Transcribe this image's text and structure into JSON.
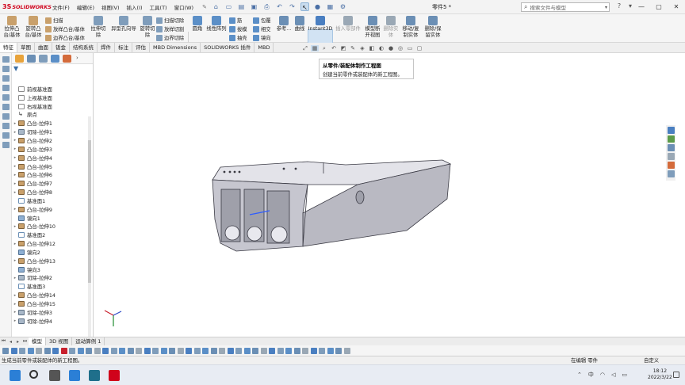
{
  "app": {
    "logo_ds": "3S",
    "logo_text": "SOLIDWORKS",
    "menus": [
      "文件(F)",
      "编辑(E)",
      "视图(V)",
      "插入(I)",
      "工具(T)",
      "窗口(W)"
    ],
    "document_title": "零件5 *",
    "search_placeholder": "搜索文件与模型"
  },
  "ribbon": {
    "buttons": [
      {
        "label": "拉伸凸\n台/基体",
        "color": "#c9a06b"
      },
      {
        "label": "旋转凸\n台/基体",
        "color": "#c9a06b"
      },
      {
        "label": "拉伸切\n除",
        "color": "#7f9dbb"
      },
      {
        "label": "异型孔向导",
        "color": "#7f9dbb"
      },
      {
        "label": "旋转切\n除",
        "color": "#7f9dbb"
      },
      {
        "label": "圆角",
        "color": "#5b8fc7"
      },
      {
        "label": "线性阵列",
        "color": "#5b8fc7"
      },
      {
        "label": "参考...",
        "color": "#6b8fb5"
      },
      {
        "label": "曲线",
        "color": "#6b8fb5"
      },
      {
        "label": "Instant3D",
        "color": "#4a7fc1"
      },
      {
        "label": "插入零部件",
        "color": "#9aa8b5"
      },
      {
        "label": "模型断\n开视图",
        "color": "#6b8fb5"
      },
      {
        "label": "删除实\n体",
        "color": "#9aa8b5"
      },
      {
        "label": "移动/复\n制实体",
        "color": "#6b8fb5"
      },
      {
        "label": "删除/保\n留实体",
        "color": "#6b8fb5"
      }
    ],
    "small": [
      "扫描",
      "放样凸台/基体",
      "边界凸台/基体",
      "扫描切除",
      "放样切割",
      "边界切除",
      "筋",
      "拔模",
      "抽壳",
      "包覆",
      "相交",
      "镜向"
    ]
  },
  "tabs": [
    "特征",
    "草图",
    "曲面",
    "钣金",
    "结构系统",
    "焊件",
    "标注",
    "评估",
    "MBD Dimensions",
    "SOLIDWORKS 插件",
    "MBD"
  ],
  "active_tab": 0,
  "tooltip": {
    "title": "从零件/装配体制作工程图",
    "desc": "创建当前零件或装配体的新工程图。"
  },
  "tree": [
    {
      "label": "前视基准面",
      "icon": "plane",
      "exp": false
    },
    {
      "label": "上视基准面",
      "icon": "plane",
      "exp": false
    },
    {
      "label": "右视基准面",
      "icon": "plane",
      "exp": false
    },
    {
      "label": "原点",
      "icon": "origin",
      "exp": false
    },
    {
      "label": "凸台-拉伸1",
      "icon": "boss",
      "exp": true
    },
    {
      "label": "切除-拉伸1",
      "icon": "cut",
      "exp": true
    },
    {
      "label": "凸台-拉伸2",
      "icon": "boss",
      "exp": true
    },
    {
      "label": "凸台-拉伸3",
      "icon": "boss",
      "exp": true
    },
    {
      "label": "凸台-拉伸4",
      "icon": "boss",
      "exp": true
    },
    {
      "label": "凸台-拉伸5",
      "icon": "boss",
      "exp": true
    },
    {
      "label": "凸台-拉伸6",
      "icon": "boss",
      "exp": true
    },
    {
      "label": "凸台-拉伸7",
      "icon": "boss",
      "exp": true
    },
    {
      "label": "凸台-拉伸8",
      "icon": "boss",
      "exp": true
    },
    {
      "label": "基准面1",
      "icon": "refplane",
      "exp": false
    },
    {
      "label": "凸台-拉伸9",
      "icon": "boss",
      "exp": true
    },
    {
      "label": "镜向1",
      "icon": "mirror",
      "exp": false
    },
    {
      "label": "凸台-拉伸10",
      "icon": "boss",
      "exp": true
    },
    {
      "label": "基准面2",
      "icon": "refplane",
      "exp": false
    },
    {
      "label": "凸台-拉伸12",
      "icon": "boss",
      "exp": true
    },
    {
      "label": "镜向2",
      "icon": "mirror",
      "exp": false
    },
    {
      "label": "凸台-拉伸13",
      "icon": "boss",
      "exp": true
    },
    {
      "label": "镜向3",
      "icon": "mirror",
      "exp": false
    },
    {
      "label": "切除-拉伸2",
      "icon": "cut",
      "exp": true
    },
    {
      "label": "基准面3",
      "icon": "refplane",
      "exp": false
    },
    {
      "label": "凸台-拉伸14",
      "icon": "boss",
      "exp": true
    },
    {
      "label": "凸台-拉伸15",
      "icon": "boss",
      "exp": true
    },
    {
      "label": "切除-拉伸3",
      "icon": "cut",
      "exp": true
    },
    {
      "label": "切除-拉伸4",
      "icon": "cut",
      "exp": true
    }
  ],
  "bottom_tabs": [
    "模型",
    "3D 视图",
    "运动算例 1"
  ],
  "active_bottom_tab": 0,
  "status": {
    "left": "生成当前零件或装配体的新工程图。",
    "mode": "在编辑 零件",
    "units": "自定义"
  },
  "taskbar": {
    "ime": "中",
    "time": "18:12",
    "date": "2022/3/22"
  },
  "colors": {
    "accent": "#4a7fc1",
    "brand_red": "#d0021b",
    "model_face": "#cfcfd6",
    "model_edge": "#3a3a44"
  }
}
